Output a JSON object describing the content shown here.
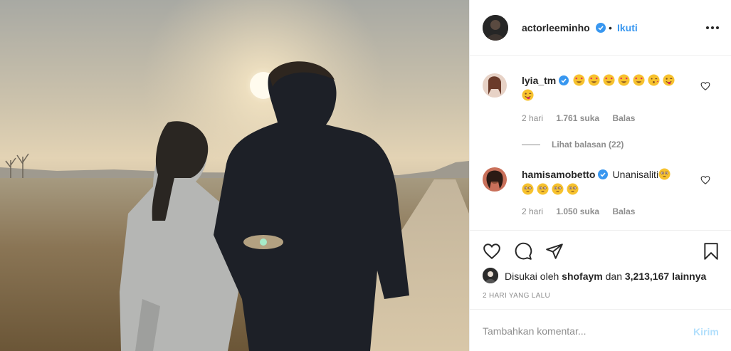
{
  "post": {
    "author": "actorleeminho",
    "separator": "•",
    "follow_label": "Ikuti",
    "more_icon": "more-icon"
  },
  "comments": [
    {
      "username": "lyia_tm",
      "verified": true,
      "emojis": [
        "heart-eyes",
        "heart-eyes",
        "heart-eyes",
        "heart-eyes",
        "heart-eyes",
        "kissing",
        "wink-tongue",
        "wink-tongue"
      ],
      "time": "2 hari",
      "likes": "1.761 suka",
      "reply_label": "Balas",
      "view_replies": "Lihat balasan (22)"
    },
    {
      "username": "hamisamobetto",
      "verified": true,
      "text": "Unanisaliti",
      "emojis": [
        "flushed",
        "flushed",
        "flushed",
        "flushed",
        "flushed"
      ],
      "time": "2 hari",
      "likes": "1.050 suka",
      "reply_label": "Balas"
    }
  ],
  "liked_by": {
    "prefix": "Disukai oleh",
    "user": "shofaym",
    "and": "dan",
    "count": "3,213,167",
    "suffix": "lainnya"
  },
  "date": "2 HARI YANG LALU",
  "add_comment": {
    "placeholder": "Tambahkan komentar...",
    "post_label": "Kirim"
  },
  "colors": {
    "link": "#3897f0",
    "verified": "#3897f0",
    "post_disabled": "#b2dffc",
    "muted": "#8e8e8e"
  }
}
